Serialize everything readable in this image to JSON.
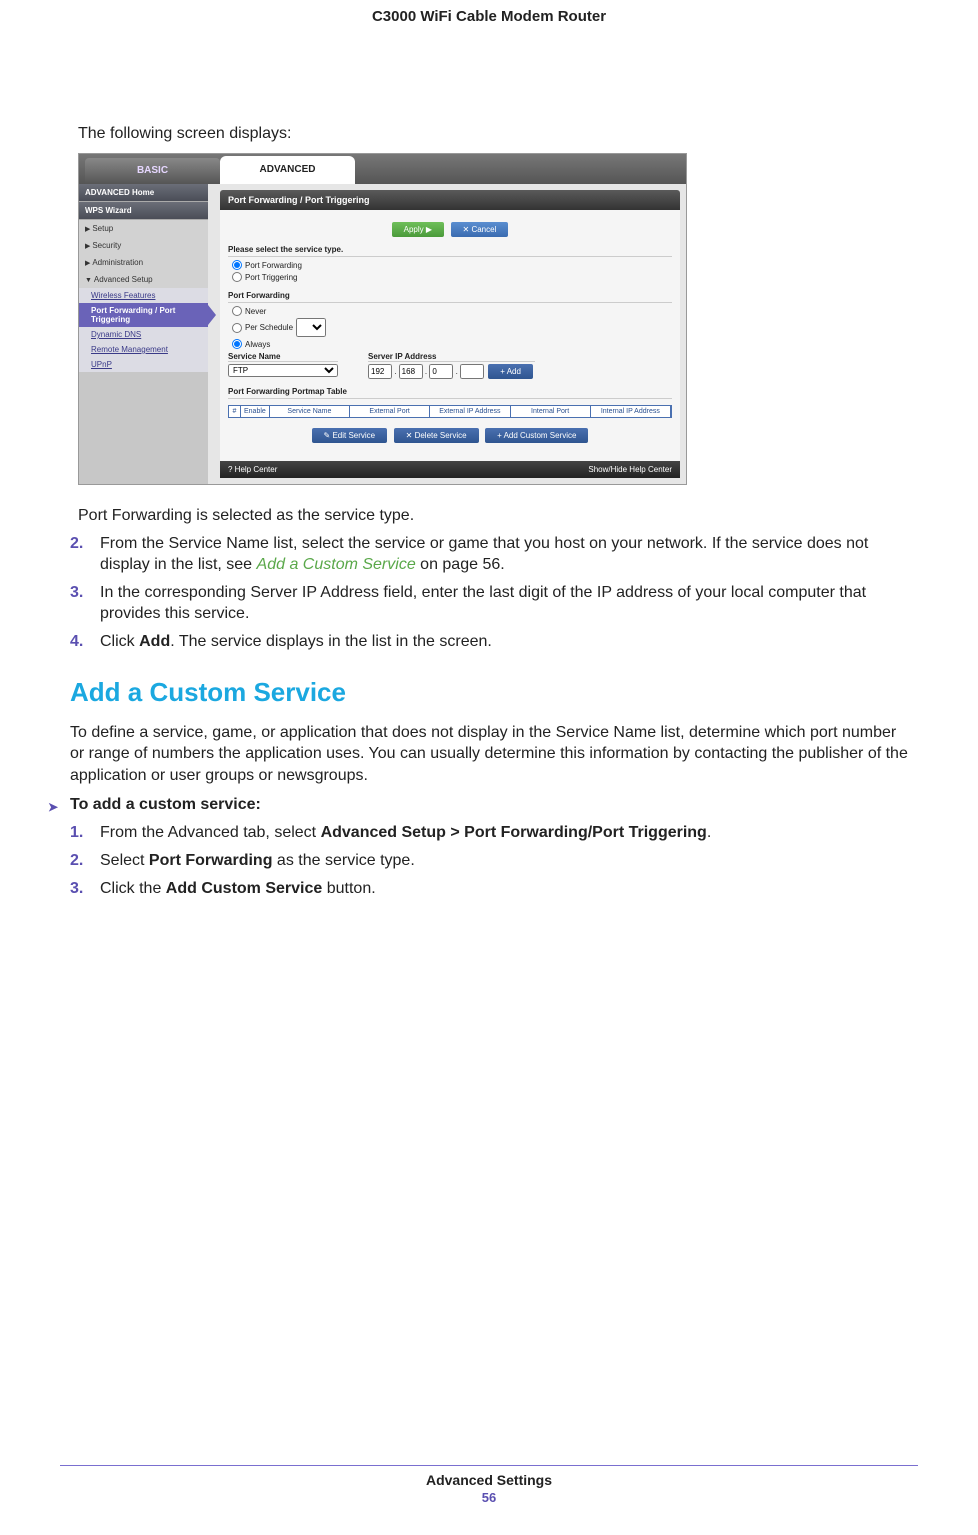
{
  "header": {
    "title": "C3000 WiFi Cable Modem Router"
  },
  "intro": "The following screen displays:",
  "screenshot": {
    "tab_basic": "BASIC",
    "tab_advanced": "ADVANCED",
    "sidebar": {
      "adv_home": "ADVANCED Home",
      "wps": "WPS Wizard",
      "setup": "Setup",
      "security": "Security",
      "admin": "Administration",
      "adv_setup": "Advanced Setup",
      "wireless": "Wireless Features",
      "portfwd": "Port Forwarding / Port Triggering",
      "ddns": "Dynamic DNS",
      "remote": "Remote Management",
      "upnp": "UPnP"
    },
    "panel": {
      "title": "Port Forwarding / Port Triggering",
      "apply": "Apply ▶",
      "cancel": "✕ Cancel",
      "select_label": "Please select the service type.",
      "opt_pf": "Port Forwarding",
      "opt_pt": "Port Triggering",
      "pf_section": "Port Forwarding",
      "never": "Never",
      "persched": "Per Schedule",
      "always": "Always",
      "service_name": "Service Name",
      "service_value": "FTP",
      "server_ip": "Server IP Address",
      "ip1": "192",
      "ip2": "168",
      "ip3": "0",
      "ip4": "",
      "add": "+ Add",
      "portmap": "Port Forwarding Portmap Table",
      "th_hash": "#",
      "th_enable": "Enable",
      "th_svc": "Service Name",
      "th_ext": "External Port",
      "th_extip": "External IP Address",
      "th_int": "Internal Port",
      "th_intip": "Internal IP Address",
      "edit": "✎ Edit Service",
      "delete": "✕ Delete Service",
      "addcustom": "+ Add Custom Service",
      "help": "? Help Center",
      "showhide": "Show/Hide Help Center"
    }
  },
  "after_shot": "Port Forwarding is selected as the service type.",
  "step2_a": "From the Service Name list, select the service or game that you host on your network. If the service does not display in the list, see ",
  "step2_link": "Add a Custom Service",
  "step2_b": " on page 56.",
  "step3": "In the corresponding Server IP Address field, enter the last digit of the IP address of your local computer that provides this service.",
  "step4_a": "Click ",
  "step4_b": "Add",
  "step4_c": ". The service displays in the list in the screen.",
  "section_heading": "Add a Custom Service",
  "section_para": "To define a service, game, or application that does not display in the Service Name list, determine which port number or range of numbers the application uses. You can usually determine this information by contacting the publisher of the application or user groups or newsgroups.",
  "proc_title": "To add a custom service:",
  "p1_a": "From the Advanced tab, select ",
  "p1_b": "Advanced Setup > Port Forwarding/Port Triggering",
  "p1_c": ".",
  "p2_a": "Select ",
  "p2_b": "Port Forwarding",
  "p2_c": " as the service type.",
  "p3_a": "Click the ",
  "p3_b": "Add Custom Service",
  "p3_c": " button.",
  "footer": {
    "section": "Advanced Settings",
    "page": "56"
  }
}
